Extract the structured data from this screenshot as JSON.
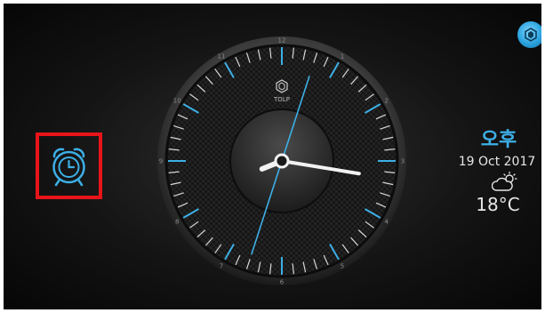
{
  "clock": {
    "brand": "TOLP",
    "numbers": [
      "12",
      "1",
      "2",
      "3",
      "4",
      "5",
      "6",
      "7",
      "8",
      "9",
      "10",
      "11"
    ],
    "time": {
      "hour": 8,
      "minute": 16,
      "second": 33
    }
  },
  "status": {
    "ampm": "오후",
    "date": "19 Oct 2017",
    "temperature": "18°C",
    "weather_icon": "partly-cloudy-icon"
  },
  "icons": {
    "alarm": "alarm-clock-icon",
    "corner": "hexagon-logo-icon"
  },
  "colors": {
    "accent": "#3dafe6",
    "highlight_box": "#e8141a",
    "text": "#e6e6e6"
  }
}
